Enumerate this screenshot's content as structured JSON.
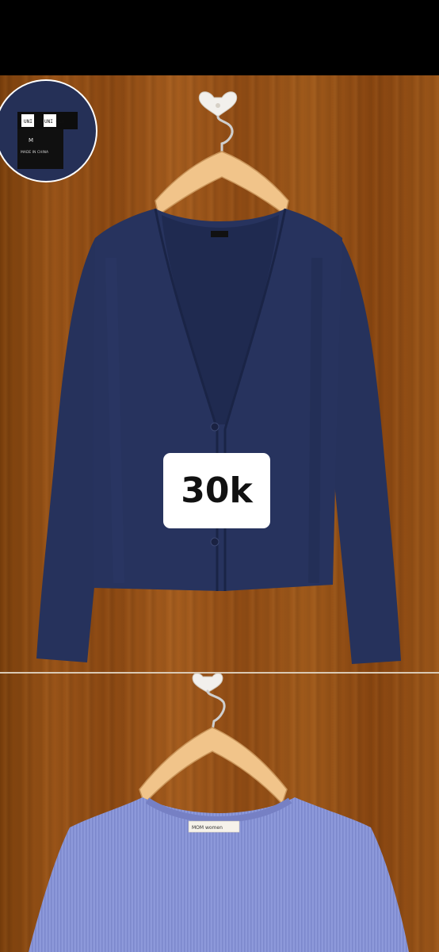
{
  "price": "30k",
  "label_closeup": {
    "brand_left": "UNI QLO",
    "brand_right": "UNI QLO",
    "size": "M",
    "origin": "MADE IN CHINA"
  },
  "second_item_label": "MOM women",
  "colors": {
    "cardigan": "#25315b",
    "tshirt": "#8b97d8",
    "wood": "#8f4b14",
    "price_tag_bg": "#ffffff"
  },
  "icons": [
    "heart-hook-icon",
    "hanger-icon"
  ]
}
